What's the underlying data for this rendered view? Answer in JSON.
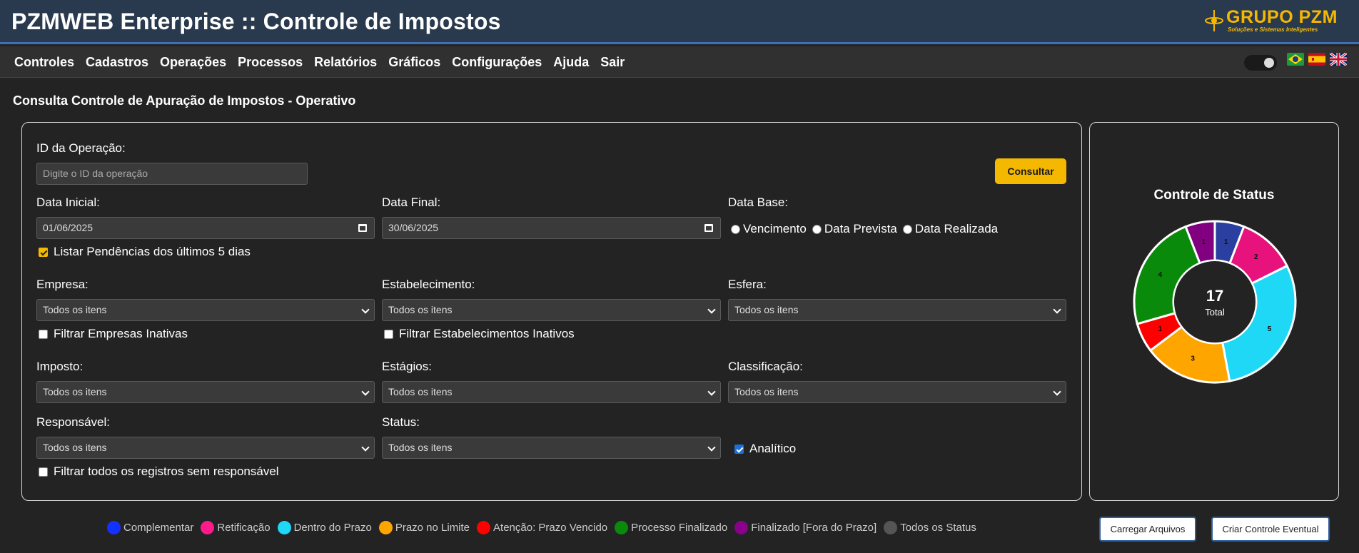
{
  "header": {
    "title": "PZMWEB Enterprise :: Controle de Impostos",
    "logo_brand": "GRUPO PZM",
    "logo_tagline": "Soluções e Sistemas Inteligentes"
  },
  "menu": {
    "items": [
      "Controles",
      "Cadastros",
      "Operações",
      "Processos",
      "Relatórios",
      "Gráficos",
      "Configurações",
      "Ajuda",
      "Sair"
    ],
    "flags": [
      "brazil-flag-icon",
      "spain-flag-icon",
      "uk-flag-icon"
    ]
  },
  "page": {
    "title": "Consulta Controle de Apuração de Impostos - Operativo"
  },
  "form": {
    "operation_id_label": "ID da Operação:",
    "operation_id_placeholder": "Digite o ID da operação",
    "consult_button": "Consultar",
    "start_date_label": "Data Inicial:",
    "start_date_value": "01/06/2025",
    "end_date_label": "Data Final:",
    "end_date_value": "30/06/2025",
    "base_date_label": "Data Base:",
    "base_date_options": [
      "Vencimento",
      "Data Prevista",
      "Data Realizada"
    ],
    "pending_checkbox_label": "Listar Pendências dos últimos 5 dias",
    "pending_checked": true,
    "company_label": "Empresa:",
    "company_value": "Todos os itens",
    "inactive_companies_label": "Filtrar Empresas Inativas",
    "establishment_label": "Estabelecimento:",
    "establishment_value": "Todos os itens",
    "inactive_establishments_label": "Filtrar Estabelecimentos Inativos",
    "sphere_label": "Esfera:",
    "sphere_value": "Todos os itens",
    "tax_label": "Imposto:",
    "tax_value": "Todos os itens",
    "stages_label": "Estágios:",
    "stages_value": "Todos os itens",
    "classification_label": "Classificação:",
    "classification_value": "Todos os itens",
    "responsible_label": "Responsável:",
    "responsible_value": "Todos os itens",
    "no_responsible_label": "Filtrar todos os registros sem responsável",
    "status_label": "Status:",
    "status_value": "Todos os itens",
    "analytic_label": "Analítico",
    "analytic_checked": true
  },
  "chart_data": {
    "type": "pie",
    "title": "Controle de Status",
    "center_value": "17",
    "center_label": "Total",
    "categories": [
      "Complementar",
      "Retificação",
      "Dentro do Prazo",
      "Prazo no Limite",
      "Atenção: Prazo Vencido",
      "Processo Finalizado",
      "Finalizado [Fora do Prazo]"
    ],
    "values": [
      1,
      2,
      5,
      3,
      1,
      4,
      1
    ],
    "colors": [
      "#2a3fa0",
      "#e8127c",
      "#1fd8f5",
      "#ffa500",
      "#ff0000",
      "#0a8a0a",
      "#800080"
    ],
    "donut": true
  },
  "legend": {
    "items": [
      {
        "label": "Complementar",
        "color": "#1432ff"
      },
      {
        "label": "Retificação",
        "color": "#ff1a8c"
      },
      {
        "label": "Dentro do Prazo",
        "color": "#1fd8f5"
      },
      {
        "label": "Prazo no Limite",
        "color": "#ffa500"
      },
      {
        "label": "Atenção: Prazo Vencido",
        "color": "#ff0000"
      },
      {
        "label": "Processo Finalizado",
        "color": "#0a8a0a"
      },
      {
        "label": "Finalizado [Fora do Prazo]",
        "color": "#8a008a"
      },
      {
        "label": "Todos os Status",
        "color": "#555555"
      }
    ]
  },
  "actions": {
    "upload_files": "Carregar Arquivos",
    "create_control": "Criar Controle Eventual"
  }
}
